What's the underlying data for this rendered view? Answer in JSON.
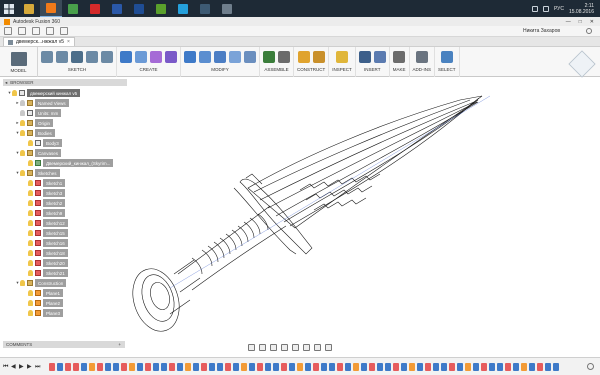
{
  "window": {
    "title": "Autodesk Fusion 360",
    "controls": [
      "—",
      "□",
      "✕"
    ]
  },
  "taskbar": {
    "apps": [
      {
        "name": "folder",
        "color": "#d6a93a"
      },
      {
        "name": "fusion",
        "color": "#f07a1a",
        "active": true
      },
      {
        "name": "chrome",
        "color": "#49a04b"
      },
      {
        "name": "opera",
        "color": "#d42a2a"
      },
      {
        "name": "photoshop",
        "color": "#2a58a8"
      },
      {
        "name": "photoshop-2",
        "color": "#1f4d94"
      },
      {
        "name": "utorrent",
        "color": "#5aa02c"
      },
      {
        "name": "skype",
        "color": "#25a0dc"
      },
      {
        "name": "app-9",
        "color": "#3d5a73"
      },
      {
        "name": "app-10",
        "color": "#6f7e8c"
      }
    ],
    "tray_lang": "РУС",
    "time": "2:11",
    "date": "15.08.2016"
  },
  "qab": {
    "user": "Никита Захаров",
    "help": "?"
  },
  "doc_tab": {
    "label": "двемерск...нжжал v5",
    "close": "×"
  },
  "ribbon": {
    "workspace": "MODEL",
    "groups": [
      {
        "label": "SKETCH",
        "icons": [
          "#6c8aa5",
          "#6c8aa5",
          "#4d6e8a",
          "#6c8aa5",
          "#6c8aa5"
        ]
      },
      {
        "label": "CREATE",
        "icons": [
          "#3e7ac8",
          "#6b9ad6",
          "#a56bd6",
          "#7a59c8"
        ]
      },
      {
        "label": "MODIFY",
        "icons": [
          "#3e7ac8",
          "#5b8ed0",
          "#4c7ec4",
          "#7aa3d8",
          "#6b8fbf"
        ]
      },
      {
        "label": "ASSEMBLE",
        "icons": [
          "#3a7d3a",
          "#6b6b6b"
        ]
      },
      {
        "label": "CONSTRUCT",
        "icons": [
          "#e0a32e",
          "#c9902b"
        ]
      },
      {
        "label": "INSPECT",
        "icons": [
          "#e0b63a"
        ]
      },
      {
        "label": "INSERT",
        "icons": [
          "#3d5f8a",
          "#5b7bb0"
        ]
      },
      {
        "label": "MAKE",
        "icons": [
          "#6c6c6c"
        ]
      },
      {
        "label": "ADD-INS",
        "icons": [
          "#6a7480"
        ]
      },
      {
        "label": "SELECT",
        "icons": [
          "#4a82c0"
        ]
      }
    ]
  },
  "browser": {
    "header": "BROWSER",
    "items": [
      {
        "label": "двемерский кинжал v5",
        "level": 0,
        "arrow": "▾",
        "bulb": true,
        "icon": "org",
        "dark": true
      },
      {
        "label": "Named Views",
        "level": 1,
        "arrow": "▸",
        "bulb": false,
        "icon": "folder"
      },
      {
        "label": "Units: mm",
        "level": 1,
        "arrow": "",
        "bulb": false,
        "icon": "org"
      },
      {
        "label": "Origin",
        "level": 1,
        "arrow": "▸",
        "bulb": true,
        "icon": "folder"
      },
      {
        "label": "Bodies",
        "level": 1,
        "arrow": "▾",
        "bulb": true,
        "icon": "folder"
      },
      {
        "label": "Body3",
        "level": 2,
        "arrow": "",
        "bulb": true,
        "icon": "org"
      },
      {
        "label": "Canvases",
        "level": 1,
        "arrow": "▾",
        "bulb": true,
        "icon": "folder"
      },
      {
        "label": "Двемерский_кинжал_(Skyrim...",
        "level": 2,
        "arrow": "",
        "bulb": true,
        "icon": "cv"
      },
      {
        "label": "Sketches",
        "level": 1,
        "arrow": "▾",
        "bulb": true,
        "icon": "folder"
      },
      {
        "label": "Sketch1",
        "level": 2,
        "arrow": "",
        "bulb": true,
        "icon": "sk"
      },
      {
        "label": "Sketch3",
        "level": 2,
        "arrow": "",
        "bulb": true,
        "icon": "sk"
      },
      {
        "label": "Sketch2",
        "level": 2,
        "arrow": "",
        "bulb": true,
        "icon": "sk"
      },
      {
        "label": "Sketch9",
        "level": 2,
        "arrow": "",
        "bulb": true,
        "icon": "sk"
      },
      {
        "label": "Sketch12",
        "level": 2,
        "arrow": "",
        "bulb": true,
        "icon": "sk"
      },
      {
        "label": "Sketch15",
        "level": 2,
        "arrow": "",
        "bulb": true,
        "icon": "sk"
      },
      {
        "label": "Sketch16",
        "level": 2,
        "arrow": "",
        "bulb": true,
        "icon": "sk"
      },
      {
        "label": "Sketch18",
        "level": 2,
        "arrow": "",
        "bulb": true,
        "icon": "sk"
      },
      {
        "label": "Sketch20",
        "level": 2,
        "arrow": "",
        "bulb": true,
        "icon": "sk"
      },
      {
        "label": "Sketch21",
        "level": 2,
        "arrow": "",
        "bulb": true,
        "icon": "sk"
      },
      {
        "label": "Construction",
        "level": 1,
        "arrow": "▾",
        "bulb": true,
        "icon": "folder"
      },
      {
        "label": "Plane1",
        "level": 2,
        "arrow": "",
        "bulb": true,
        "icon": "pl"
      },
      {
        "label": "Plane2",
        "level": 2,
        "arrow": "",
        "bulb": true,
        "icon": "pl"
      },
      {
        "label": "Plane3",
        "level": 2,
        "arrow": "",
        "bulb": true,
        "icon": "pl"
      }
    ]
  },
  "comments": {
    "label": "COMMENTS",
    "add": "+"
  },
  "timeline": {
    "controls": [
      "⏮",
      "◀",
      "▶",
      "▶",
      "⏭"
    ],
    "item_colors": [
      "#e65c5c",
      "#3e7ac8",
      "#e65c5c",
      "#e65c5c",
      "#3e7ac8",
      "#f39b35",
      "#e65c5c",
      "#3e7ac8",
      "#3e7ac8",
      "#e65c5c",
      "#f39b35",
      "#3e7ac8",
      "#e65c5c",
      "#3e7ac8",
      "#3e7ac8",
      "#e65c5c",
      "#3e7ac8",
      "#f39b35",
      "#3e7ac8",
      "#e65c5c",
      "#3e7ac8",
      "#3e7ac8",
      "#e65c5c",
      "#3e7ac8",
      "#f39b35",
      "#3e7ac8",
      "#e65c5c",
      "#3e7ac8",
      "#3e7ac8",
      "#e65c5c",
      "#3e7ac8",
      "#f39b35",
      "#3e7ac8",
      "#e65c5c",
      "#3e7ac8",
      "#3e7ac8",
      "#e65c5c",
      "#3e7ac8",
      "#f39b35",
      "#3e7ac8",
      "#e65c5c",
      "#3e7ac8",
      "#3e7ac8",
      "#e65c5c",
      "#3e7ac8",
      "#f39b35",
      "#3e7ac8",
      "#e65c5c",
      "#3e7ac8",
      "#3e7ac8",
      "#e65c5c",
      "#3e7ac8",
      "#f39b35",
      "#3e7ac8",
      "#e65c5c",
      "#3e7ac8",
      "#3e7ac8",
      "#e65c5c",
      "#3e7ac8",
      "#f39b35",
      "#3e7ac8",
      "#e65c5c",
      "#3e7ac8",
      "#3e7ac8"
    ]
  }
}
